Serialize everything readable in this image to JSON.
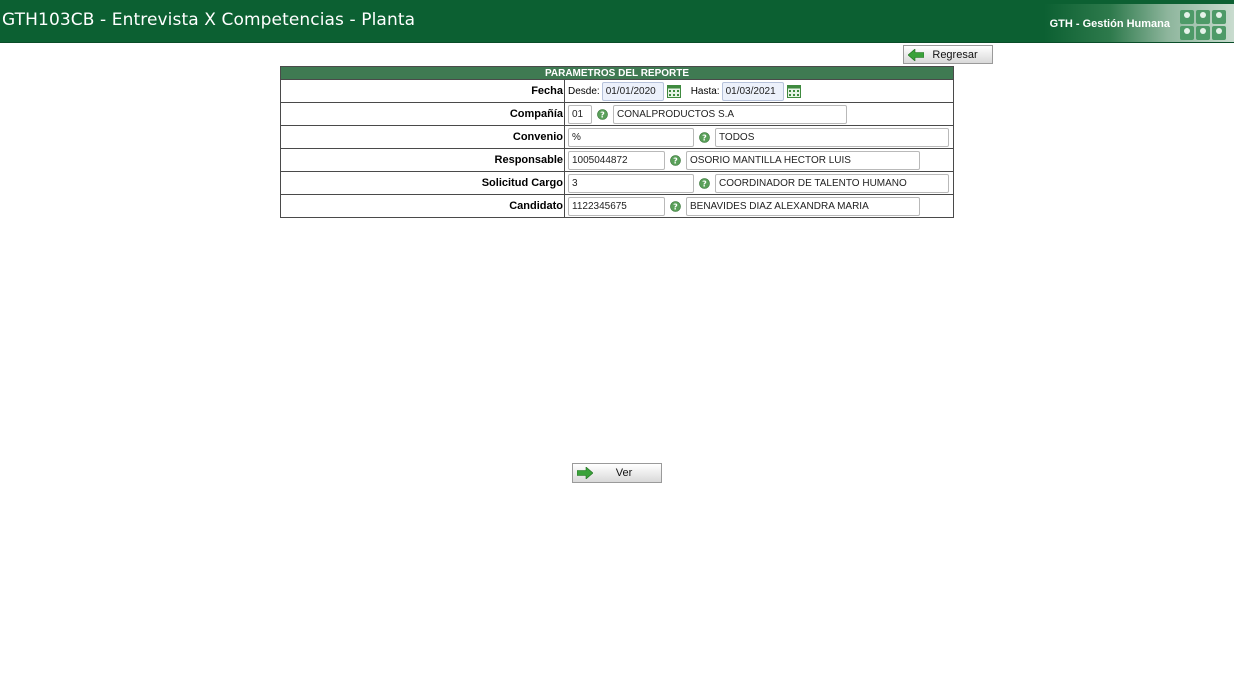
{
  "header": {
    "title": "GTH103CB - Entrevista X Competencias - Planta",
    "brand": "GTH - Gestión Humana"
  },
  "buttons": {
    "back_label": "Regresar",
    "view_label": "Ver"
  },
  "params": {
    "heading": "PARAMETROS DEL REPORTE",
    "fecha": {
      "label": "Fecha",
      "desde_label": "Desde:",
      "desde": "01/01/2020",
      "hasta_label": "Hasta:",
      "hasta": "01/03/2021"
    },
    "compania": {
      "label": "Compañía",
      "code": "01",
      "name": "CONALPRODUCTOS S.A"
    },
    "convenio": {
      "label": "Convenio",
      "code": "%",
      "name": "TODOS"
    },
    "responsable": {
      "label": "Responsable",
      "code": "1005044872",
      "name": "OSORIO MANTILLA HECTOR LUIS"
    },
    "solicitud_cargo": {
      "label": "Solicitud Cargo",
      "code": "3",
      "name": "COORDINADOR DE TALENTO HUMANO"
    },
    "candidato": {
      "label": "Candidato",
      "code": "1122345675",
      "name": "BENAVIDES DIAZ ALEXANDRA MARIA"
    }
  },
  "icons": {
    "back": "arrow-left-icon",
    "view": "arrow-right-icon",
    "calendar": "calendar-icon",
    "help": "help-icon"
  },
  "colors": {
    "header_bg": "#0c6032",
    "table_heading_bg": "#3f7a52",
    "date_input_bg": "#ecf1fb"
  }
}
